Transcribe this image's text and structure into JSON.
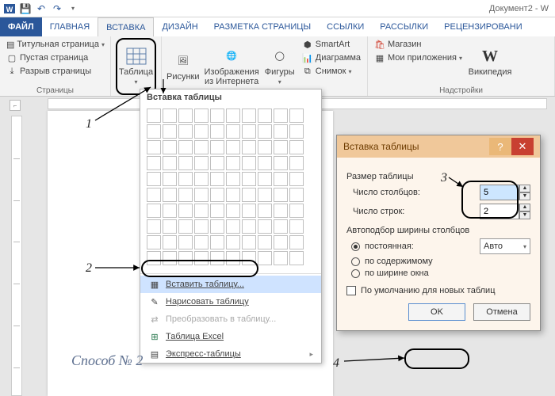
{
  "titlebar": {
    "doc_title": "Документ2 - W"
  },
  "tabs": {
    "file": "ФАЙЛ",
    "home": "ГЛАВНАЯ",
    "insert": "ВСТАВКА",
    "design": "ДИЗАЙН",
    "layout": "РАЗМЕТКА СТРАНИЦЫ",
    "references": "ССЫЛКИ",
    "mailings": "РАССЫЛКИ",
    "review": "РЕЦЕНЗИРОВАНИ"
  },
  "ribbon": {
    "pages": {
      "label": "Страницы",
      "cover": "Титульная страница",
      "blank": "Пустая страница",
      "break": "Разрыв страницы"
    },
    "table": {
      "label": "Таблица"
    },
    "illus": {
      "pictures": "Рисунки",
      "online": "Изображения из Интернета",
      "shapes": "Фигуры",
      "smartart": "SmartArt",
      "chart": "Диаграмма",
      "screenshot": "Снимок"
    },
    "addins": {
      "label": "Надстройки",
      "store": "Магазин",
      "myapps": "Мои приложения",
      "wiki": "Википедия"
    }
  },
  "dropdown": {
    "header": "Вставка таблицы",
    "insert": "Вставить таблицу...",
    "draw": "Нарисовать таблицу",
    "convert": "Преобразовать в таблицу...",
    "excel": "Таблица Excel",
    "quick": "Экспресс-таблицы"
  },
  "dialog": {
    "title": "Вставка таблицы",
    "size_section": "Размер таблицы",
    "cols_label": "Число столбцов:",
    "cols_value": "5",
    "rows_label": "Число строк:",
    "rows_value": "2",
    "autofit_section": "Автоподбор ширины столбцов",
    "fixed": "постоянная:",
    "fixed_value": "Авто",
    "contents": "по содержимому",
    "window": "по ширине окна",
    "remember": "По умолчанию для новых таблиц",
    "ok": "OK",
    "cancel": "Отмена"
  },
  "annotations": {
    "n1": "1",
    "n2": "2",
    "n3": "3",
    "n4": "4",
    "method": "Способ № 2"
  },
  "colors": {
    "accent": "#2b579a",
    "dlg_header": "#f0c89a",
    "dlg_body": "#fdf5ec"
  }
}
